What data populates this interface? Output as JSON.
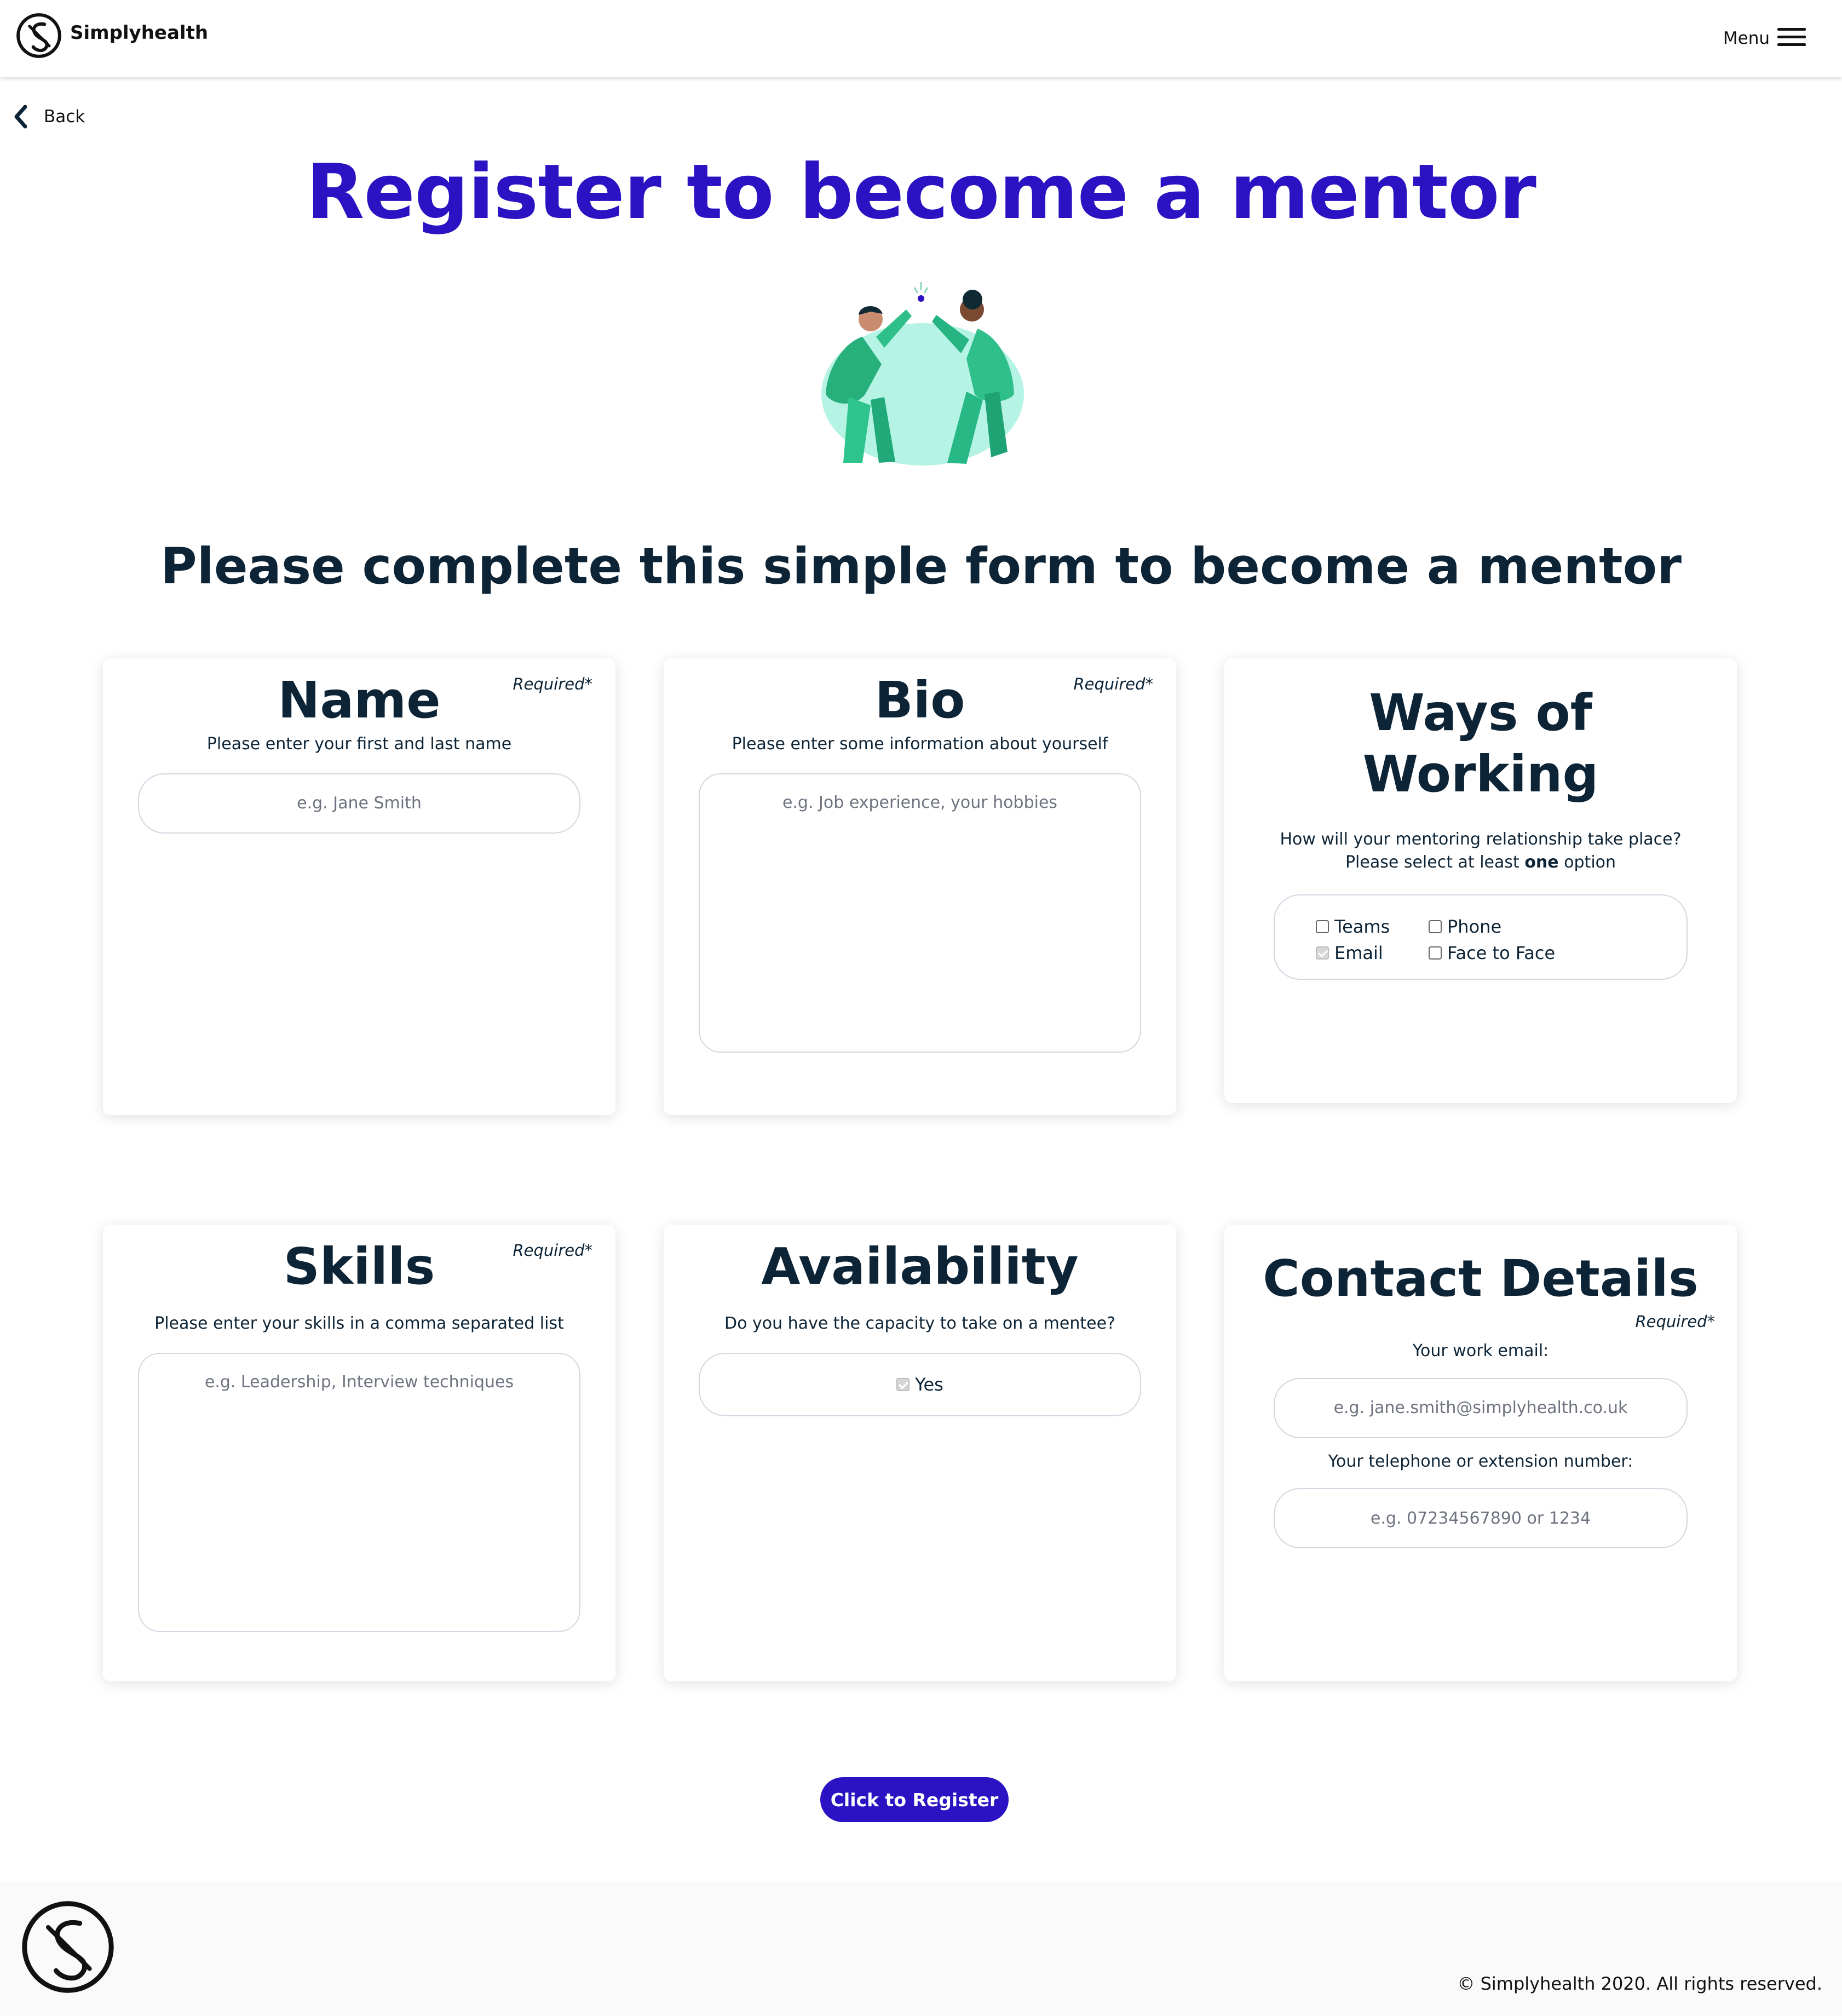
{
  "header": {
    "brand": "Simplyhealth",
    "menu_label": "Menu"
  },
  "nav": {
    "back_label": "Back"
  },
  "page": {
    "title": "Register to become a mentor",
    "subtitle": "Please complete this simple form to become a mentor"
  },
  "cards": {
    "name": {
      "title": "Name",
      "required": "Required*",
      "description": "Please enter your first and last name",
      "placeholder": "e.g. Jane Smith"
    },
    "bio": {
      "title": "Bio",
      "required": "Required*",
      "description": "Please enter some information about yourself",
      "placeholder": "e.g. Job experience, your hobbies"
    },
    "ways": {
      "title_line1": "Ways of",
      "title_line2": "Working",
      "question": "How will your mentoring relationship take place?",
      "instruction_pre": "Please select at least ",
      "instruction_bold": "one",
      "instruction_post": " option",
      "options": [
        {
          "label": "Teams",
          "checked": false
        },
        {
          "label": "Phone",
          "checked": false
        },
        {
          "label": "Email",
          "checked": true
        },
        {
          "label": "Face to Face",
          "checked": false
        }
      ]
    },
    "skills": {
      "title": "Skills",
      "required": "Required*",
      "description": "Please enter your skills in a comma separated list",
      "placeholder": "e.g. Leadership, Interview techniques"
    },
    "availability": {
      "title": "Availability",
      "question": "Do you have the capacity to take on a mentee?",
      "option_label": "Yes",
      "option_checked": true
    },
    "contact": {
      "title": "Contact Details",
      "required": "Required*",
      "email_label": "Your work email:",
      "email_placeholder": "e.g. jane.smith@simplyhealth.co.uk",
      "phone_label": "Your telephone or extension number:",
      "phone_placeholder": "e.g. 07234567890 or 1234"
    }
  },
  "actions": {
    "register_label": "Click to Register"
  },
  "footer": {
    "copyright": "© Simplyhealth 2020. All rights reserved."
  },
  "colors": {
    "primary": "#2b12c2",
    "heading": "#0d2436",
    "accent_green": "#2fbf8a"
  }
}
